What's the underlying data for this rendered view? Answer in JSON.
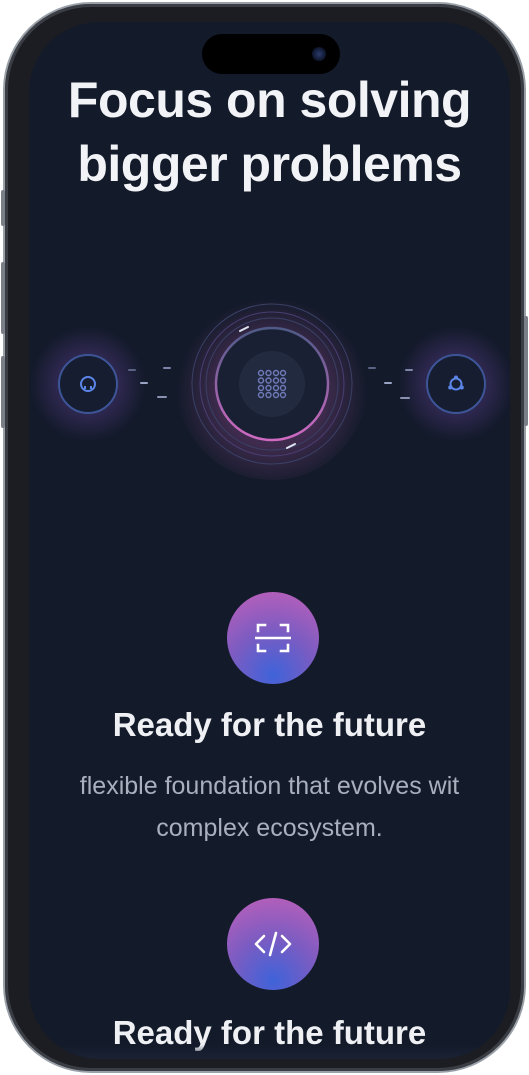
{
  "headline": {
    "line1": "Focus on solving",
    "line2": "bigger problems"
  },
  "integrations": {
    "left_icon": "github-icon",
    "center_icon": "grid-dots-icon",
    "right_icon": "ubuntu-icon"
  },
  "features": [
    {
      "icon": "scan-icon",
      "title": "Ready for the future",
      "description_line1": "flexible foundation that evolves wit",
      "description_line2": "complex ecosystem."
    },
    {
      "icon": "code-icon",
      "title": "Ready for the future"
    }
  ],
  "colors": {
    "background": "#131a2a",
    "accent_pink": "#c25fb8",
    "accent_blue": "#3f63d9"
  }
}
